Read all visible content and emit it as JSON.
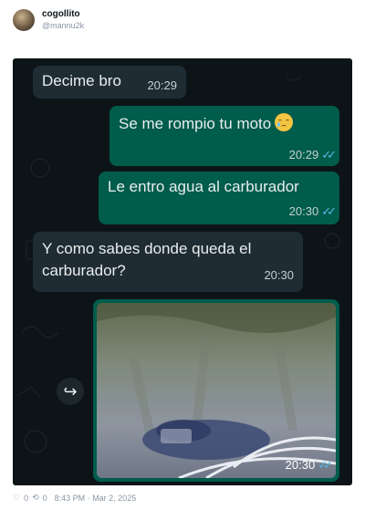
{
  "tweet": {
    "display_name": "cogollito",
    "handle": "@mannu2k"
  },
  "messages": [
    {
      "dir": "in",
      "text": "Decime bro",
      "time": "20:29"
    },
    {
      "dir": "out",
      "text": "Se me rompio tu moto",
      "emoji": "sad-face-emoji",
      "time": "20:29"
    },
    {
      "dir": "out",
      "text": "Le entro agua al carburador",
      "time": "20:30"
    },
    {
      "dir": "in",
      "text_line1": "Y como sabes donde queda el",
      "text_line2": "carburador?",
      "time": "20:30"
    },
    {
      "dir": "out",
      "type": "photo",
      "description_icon": "image-icon",
      "time": "20:30"
    }
  ],
  "read_ticks": "✓✓",
  "forward_icon": "↪",
  "footer": {
    "likes": "0",
    "retweets": "0",
    "timestamp": "8:43 PM · Mar 2, 2025"
  },
  "colors": {
    "chat_bg": "#0d1418",
    "incoming_bubble": "#1f2c33",
    "outgoing_bubble": "#005c4b",
    "read_ticks": "#53bdeb"
  }
}
